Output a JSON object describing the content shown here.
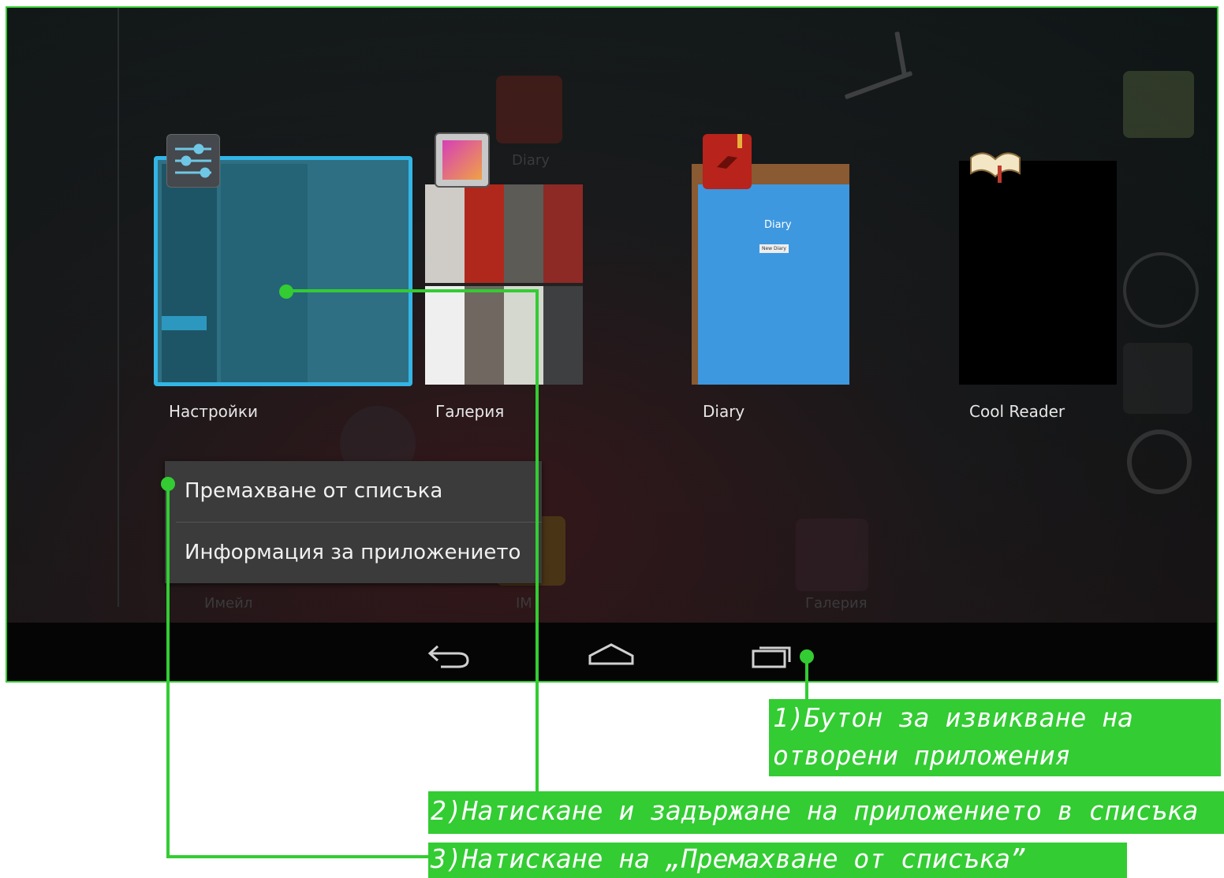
{
  "recent_apps": [
    {
      "name": "Настройки",
      "icon": "settings-sliders-icon"
    },
    {
      "name": "Галерия",
      "icon": "gallery-icon"
    },
    {
      "name": "Diary",
      "icon": "diary-book-icon",
      "thumb_title": "Diary",
      "thumb_button": "New Diary"
    },
    {
      "name": "Cool Reader",
      "icon": "open-book-icon"
    }
  ],
  "context_menu": {
    "remove": "Премахване от списъка",
    "info": "Информация за приложението"
  },
  "background_labels": {
    "email": "Имейл",
    "im": "IM",
    "gallery": "Галерия",
    "diary": "Diary"
  },
  "navbar": {
    "back": "back-icon",
    "home": "home-icon",
    "recents": "recent-apps-icon"
  },
  "annotations": {
    "step1_line1": "1)Бутон за извикване на",
    "step1_line2": "отворени приложения",
    "step2": "2)Натискане и задържане на приложението в списъка",
    "step3": "3)Натискане на „Премахване от списъка”"
  },
  "colors": {
    "accent_green": "#33cc33",
    "selection_blue": "#33b5e5"
  }
}
